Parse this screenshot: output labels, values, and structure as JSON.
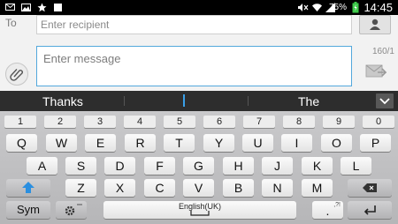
{
  "status_bar": {
    "time": "14:45",
    "battery_percent": "75%",
    "icons": [
      "message-icon",
      "image-icon",
      "star-icon",
      "notification-icon",
      "mute-icon",
      "wifi-icon",
      "signal-icon",
      "battery-icon"
    ]
  },
  "compose": {
    "to_label": "To",
    "recipient_placeholder": "Enter recipient",
    "message_placeholder": "Enter message",
    "char_count": "160/1"
  },
  "suggestions": {
    "left": "Thanks",
    "middle": "I",
    "right": "The"
  },
  "keyboard": {
    "numbers": [
      "1",
      "2",
      "3",
      "4",
      "5",
      "6",
      "7",
      "8",
      "9",
      "0"
    ],
    "row1": [
      "Q",
      "W",
      "E",
      "R",
      "T",
      "Y",
      "U",
      "I",
      "O",
      "P"
    ],
    "row2": [
      "A",
      "S",
      "D",
      "F",
      "G",
      "H",
      "J",
      "K",
      "L"
    ],
    "row3": [
      "Z",
      "X",
      "C",
      "V",
      "B",
      "N",
      "M"
    ],
    "sym_label": "Sym",
    "space_label": "English(UK)",
    "period_label": ".",
    "period_hint": ",?!"
  },
  "colors": {
    "status_bar_bg": "#000000",
    "accent": "#3aa0e8",
    "battery": "#3ec94a",
    "suggest_bg": "#2d2d2d"
  }
}
